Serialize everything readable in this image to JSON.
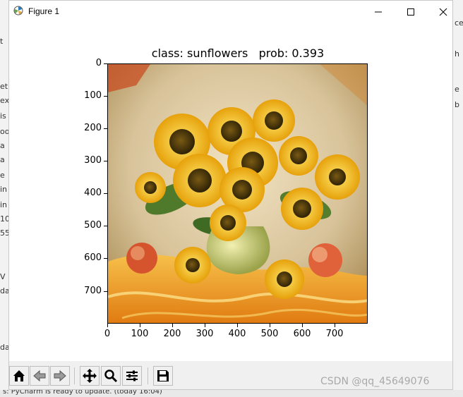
{
  "window": {
    "title": "Figure 1"
  },
  "figure": {
    "title": "class: sunflowers   prob: 0.393",
    "image_description_icon": "sunflowers-painting",
    "y_ticks": [
      "0",
      "100",
      "200",
      "300",
      "400",
      "500",
      "600",
      "700"
    ],
    "x_ticks": [
      "0",
      "100",
      "200",
      "300",
      "400",
      "500",
      "600",
      "700"
    ],
    "image_extent": [
      0,
      800
    ]
  },
  "toolbar": {
    "buttons": [
      {
        "name": "home-button",
        "icon": "home-icon"
      },
      {
        "name": "back-button",
        "icon": "arrow-left-icon"
      },
      {
        "name": "forward-button",
        "icon": "arrow-right-icon"
      },
      {
        "name": "pan-button",
        "icon": "move-icon"
      },
      {
        "name": "zoom-button",
        "icon": "magnifier-icon"
      },
      {
        "name": "configure-subplots-button",
        "icon": "sliders-icon"
      },
      {
        "name": "save-button",
        "icon": "floppy-disk-icon"
      }
    ]
  },
  "background": {
    "status_text": "s: PyCharm is ready to update. (today 16:04)",
    "left_fragments": [
      "t",
      "et",
      "ex",
      "is",
      "oo",
      "a",
      "a",
      "e",
      "in",
      "in",
      "10",
      "55",
      "V",
      "da",
      "da"
    ],
    "right_fragments": [
      "ce",
      "h",
      "e",
      "b"
    ]
  },
  "watermark": "CSDN @qq_45649076",
  "colors": {
    "window_bg": "#ffffff",
    "toolbar_bg": "#f0f0f0"
  }
}
